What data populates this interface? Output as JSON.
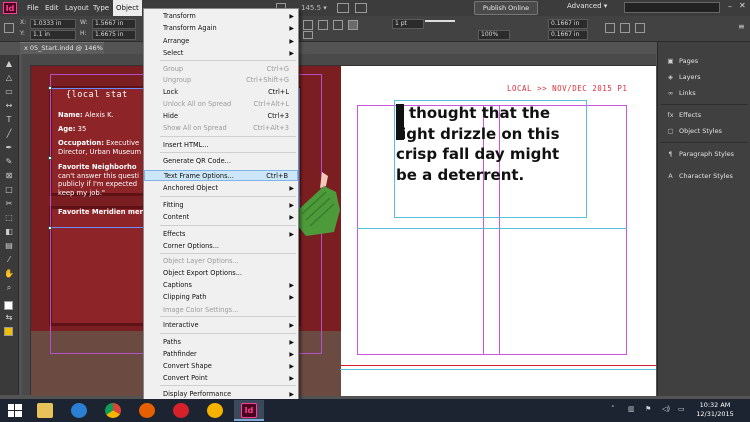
{
  "menubar": {
    "items": [
      "File",
      "Edit",
      "Layout",
      "Type",
      "Object",
      "Table",
      "View"
    ],
    "active": "Object",
    "zoom": "145.5",
    "publish_label": "Publish Online",
    "workspace_label": "Advanced"
  },
  "controlbar": {
    "x_value": "1.0333 in",
    "y_value": "1.1 in",
    "w_value": "1.5667 in",
    "h_value": "1.6675 in",
    "stroke_value": "1 pt",
    "percent_value": "100%",
    "size_value": "0.1667 in",
    "size2_value": "0.1667 in"
  },
  "document": {
    "tab_label": "x 05_Start.indd @ 146%"
  },
  "page": {
    "local_title": "{local stat",
    "name_label": "Name:",
    "name_value": "Alexis K.",
    "age_label": "Age:",
    "age_value": "35",
    "occupation_label": "Occupation:",
    "occupation_value": "Executive",
    "occupation_line2": "Director, Urban Museum",
    "fav_label": "Favorite Neighborho",
    "fav_line2": "can't answer this questi",
    "fav_line3": "publicly if I'm expected",
    "fav_line4": "keep my job.\"",
    "fav2_label": "Favorite Meridien mer",
    "running_head": "LOCAL >> NOV/DEC 2015  P1",
    "quote_line1": "thought that the",
    "quote_line2": "light drizzle on this",
    "quote_line3": "crisp fall day might",
    "quote_line4": "be a deterrent."
  },
  "panels": {
    "items": [
      {
        "label": "Pages",
        "icon": "pages-icon"
      },
      {
        "label": "Layers",
        "icon": "layers-icon"
      },
      {
        "label": "Links",
        "icon": "links-icon"
      },
      {
        "label": "Effects",
        "icon": "effects-icon"
      },
      {
        "label": "Object Styles",
        "icon": "object-styles-icon"
      },
      {
        "label": "Paragraph Styles",
        "icon": "paragraph-styles-icon"
      },
      {
        "label": "Character Styles",
        "icon": "character-styles-icon"
      }
    ]
  },
  "object_menu": {
    "items": [
      {
        "label": "Transform",
        "shortcut": "",
        "submenu": true,
        "disabled": false
      },
      {
        "label": "Transform Again",
        "shortcut": "",
        "submenu": true,
        "disabled": false
      },
      {
        "label": "Arrange",
        "shortcut": "",
        "submenu": true,
        "disabled": false
      },
      {
        "label": "Select",
        "shortcut": "",
        "submenu": true,
        "disabled": false
      },
      {
        "label": "Group",
        "shortcut": "Ctrl+G",
        "submenu": false,
        "disabled": true
      },
      {
        "label": "Ungroup",
        "shortcut": "Ctrl+Shift+G",
        "submenu": false,
        "disabled": true
      },
      {
        "label": "Lock",
        "shortcut": "Ctrl+L",
        "submenu": false,
        "disabled": false
      },
      {
        "label": "Unlock All on Spread",
        "shortcut": "Ctrl+Alt+L",
        "submenu": false,
        "disabled": true
      },
      {
        "label": "Hide",
        "shortcut": "Ctrl+3",
        "submenu": false,
        "disabled": false
      },
      {
        "label": "Show All on Spread",
        "shortcut": "Ctrl+Alt+3",
        "submenu": false,
        "disabled": true
      },
      {
        "label": "Insert HTML...",
        "shortcut": "",
        "submenu": false,
        "disabled": false
      },
      {
        "label": "Generate QR Code...",
        "shortcut": "",
        "submenu": false,
        "disabled": false
      },
      {
        "label": "Text Frame Options...",
        "shortcut": "Ctrl+B",
        "submenu": false,
        "disabled": false,
        "highlighted": true
      },
      {
        "label": "Anchored Object",
        "shortcut": "",
        "submenu": true,
        "disabled": false
      },
      {
        "label": "Fitting",
        "shortcut": "",
        "submenu": true,
        "disabled": false
      },
      {
        "label": "Content",
        "shortcut": "",
        "submenu": true,
        "disabled": false
      },
      {
        "label": "Effects",
        "shortcut": "",
        "submenu": true,
        "disabled": false
      },
      {
        "label": "Corner Options...",
        "shortcut": "",
        "submenu": false,
        "disabled": false
      },
      {
        "label": "Object Layer Options...",
        "shortcut": "",
        "submenu": false,
        "disabled": true
      },
      {
        "label": "Object Export Options...",
        "shortcut": "",
        "submenu": false,
        "disabled": false
      },
      {
        "label": "Captions",
        "shortcut": "",
        "submenu": true,
        "disabled": false
      },
      {
        "label": "Clipping Path",
        "shortcut": "",
        "submenu": true,
        "disabled": false
      },
      {
        "label": "Image Color Settings...",
        "shortcut": "",
        "submenu": false,
        "disabled": true
      },
      {
        "label": "Interactive",
        "shortcut": "",
        "submenu": true,
        "disabled": false
      },
      {
        "label": "Paths",
        "shortcut": "",
        "submenu": true,
        "disabled": false
      },
      {
        "label": "Pathfinder",
        "shortcut": "",
        "submenu": true,
        "disabled": false
      },
      {
        "label": "Convert Shape",
        "shortcut": "",
        "submenu": true,
        "disabled": false
      },
      {
        "label": "Convert Point",
        "shortcut": "",
        "submenu": true,
        "disabled": false
      },
      {
        "label": "Display Performance",
        "shortcut": "",
        "submenu": true,
        "disabled": false
      }
    ]
  },
  "taskbar": {
    "time": "10:32 AM",
    "date": "12/31/2015",
    "apps": [
      "windows-start-icon",
      "file-explorer-icon",
      "internet-explorer-icon",
      "chrome-icon",
      "firefox-icon",
      "opera-icon",
      "windows-media-icon",
      "indesign-icon"
    ]
  },
  "colors": {
    "indesign_pink": "#ff3f94",
    "menu_highlight": "#cde6f7",
    "running_head_red": "#d8323e",
    "door_red": "#7a1e22",
    "guide_magenta": "#cc55dd"
  }
}
